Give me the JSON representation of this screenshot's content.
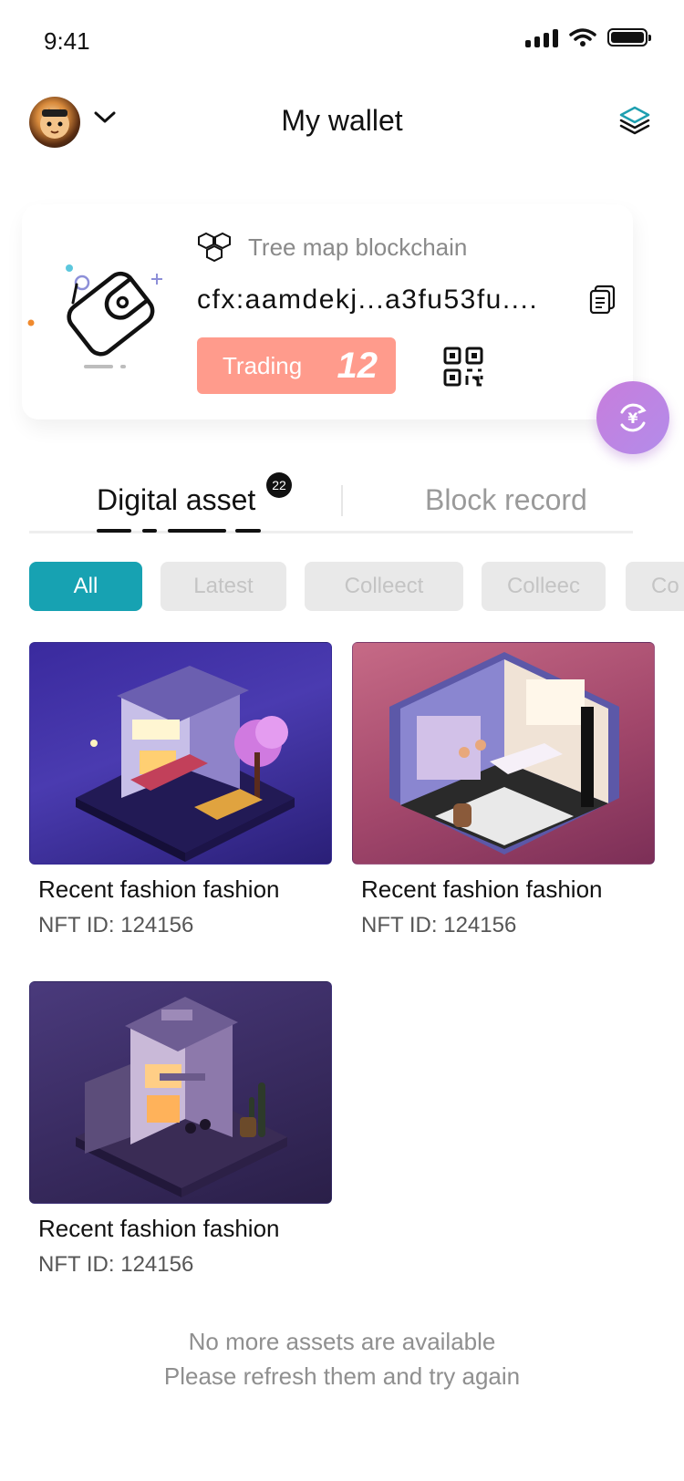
{
  "status_bar": {
    "time": "9:41"
  },
  "header": {
    "title": "My wallet"
  },
  "wallet": {
    "chain_name": "Tree map blockchain",
    "address": "cfx:aamdekj...a3fu53fu....",
    "trading_label": "Trading",
    "trading_count": "12"
  },
  "tabs": [
    {
      "label": "Digital asset",
      "badge": "22",
      "active": true
    },
    {
      "label": "Block record",
      "active": false
    }
  ],
  "filters": [
    "All",
    "Latest",
    "Colleect",
    "Colleec",
    "Co"
  ],
  "assets": [
    {
      "title": "Recent fashion fashion",
      "nft_id": "NFT ID: 124156"
    },
    {
      "title": "Recent fashion fashion",
      "nft_id": "NFT ID: 124156"
    },
    {
      "title": "Recent fashion fashion",
      "nft_id": "NFT ID: 124156"
    }
  ],
  "footer": {
    "line1": "No more assets are available",
    "line2": "Please refresh them and try again"
  },
  "colors": {
    "accent": "#17a2b2",
    "trading": "#ff9b8c",
    "fab": "#c77ddc",
    "chip_inactive": "#e9e9e9"
  }
}
